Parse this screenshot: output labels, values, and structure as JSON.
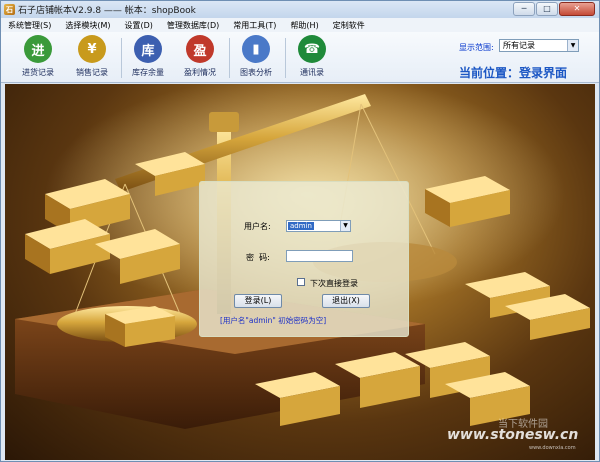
{
  "window": {
    "title": "石子店铺帐本V2.9.8 —— 帐本：shopBook",
    "app_icon_glyph": "石",
    "controls": [
      "─",
      "□",
      "✕"
    ]
  },
  "menu": [
    "系统管理(S)",
    "选择模块(M)",
    "设置(D)",
    "管理数据库(D)",
    "常用工具(T)",
    "帮助(H)",
    "定制软件"
  ],
  "toolbar": {
    "items": [
      {
        "label": "进货记录",
        "icon": "purchase-icon",
        "glyph": "进",
        "color": "#3a9a3a"
      },
      {
        "label": "销售记录",
        "icon": "sales-icon",
        "glyph": "¥",
        "color": "#c89a1c"
      },
      {
        "label": "库存余量",
        "icon": "inventory-icon",
        "glyph": "库",
        "color": "#3c5fb0"
      },
      {
        "label": "盈利情况",
        "icon": "profit-icon",
        "glyph": "盈",
        "color": "#c0392b"
      },
      {
        "label": "图表分析",
        "icon": "chart-icon",
        "glyph": "▮",
        "color": "#4a79c8"
      },
      {
        "label": "通讯录",
        "icon": "phone-icon",
        "glyph": "☎",
        "color": "#1f8a3a"
      }
    ],
    "range_label": "显示范围:",
    "range_value": "所有记录",
    "location": "当前位置：登录界面"
  },
  "login": {
    "username_label": "用户名:",
    "username_value": "admin",
    "password_label": "密  码:",
    "remember_label": "下次直接登录",
    "login_button": "登录(L)",
    "exit_button": "退出(X)",
    "hint": "[用户名\"admin\" 初始密码为空]"
  },
  "watermark": {
    "text": "www.stonesw.cn",
    "logo": "当下软件园",
    "sub": "www.downxia.com"
  }
}
